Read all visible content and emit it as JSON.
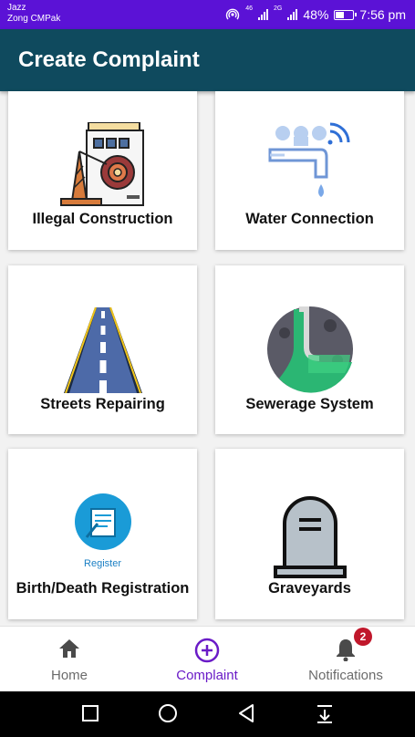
{
  "status_bar": {
    "carrier_line1": "Jazz",
    "carrier_line2": "Zong CMPak",
    "net1": "46",
    "net2": "2G",
    "battery": "48%",
    "battery_level": 0.48,
    "time": "7:56 pm"
  },
  "header": {
    "title": "Create Complaint"
  },
  "cards": [
    {
      "label": "Illegal Construction",
      "icon": "construction-building-icon"
    },
    {
      "label": "Water Connection",
      "icon": "water-tap-icon"
    },
    {
      "label": "Streets Repairing",
      "icon": "road-icon"
    },
    {
      "label": "Sewerage System",
      "icon": "sewerage-icon"
    },
    {
      "label": "Birth/Death Registration",
      "icon": "register-document-icon",
      "icon_caption": "Register"
    },
    {
      "label": "Graveyards",
      "icon": "tombstone-icon"
    }
  ],
  "bottom_nav": {
    "home": "Home",
    "complaint": "Complaint",
    "notifications": "Notifications",
    "notification_count": "2",
    "active": "complaint"
  },
  "colors": {
    "status_bar": "#5b12d6",
    "app_bar": "#0f4a5e",
    "accent": "#6a1bc7",
    "badge": "#c0172b"
  }
}
